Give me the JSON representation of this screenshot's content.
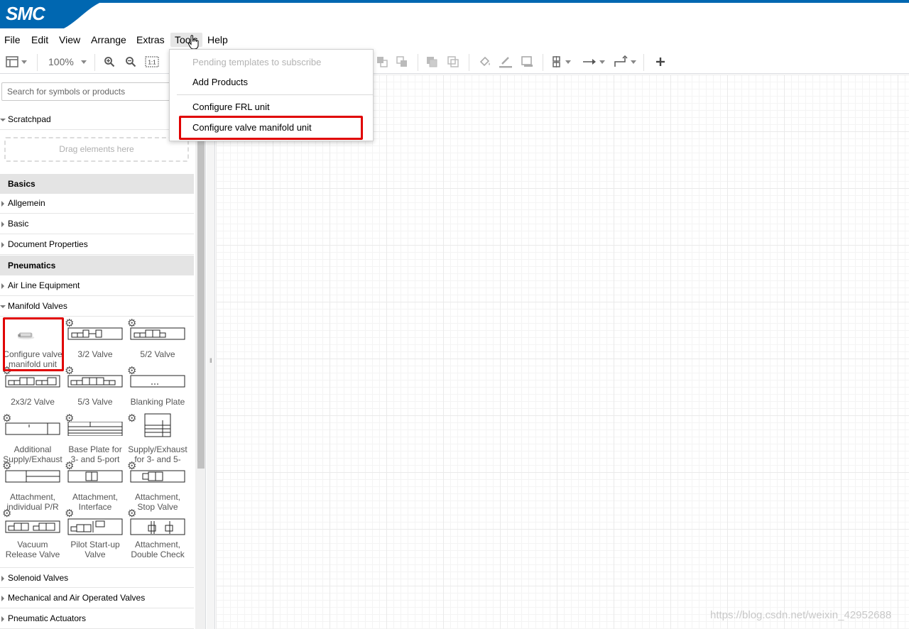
{
  "brand": {
    "logo_text": "SMC",
    "accent": "#0067b1",
    "highlight": "#e00000"
  },
  "menu": [
    "File",
    "Edit",
    "View",
    "Arrange",
    "Extras",
    "Tools",
    "Help"
  ],
  "toolbar": {
    "zoom": "100%"
  },
  "tools_menu": {
    "items": [
      {
        "label": "Pending templates to subscribe",
        "enabled": false
      },
      {
        "label": "Add Products",
        "enabled": true
      },
      {
        "label": "Configure FRL unit",
        "enabled": true
      },
      {
        "label": "Configure valve manifold unit",
        "enabled": true,
        "highlighted": true
      }
    ]
  },
  "sidebar": {
    "search_placeholder": "Search for symbols or products",
    "scratchpad": "Scratchpad",
    "drag_hint": "Drag elements here",
    "basics_header": "Basics",
    "basics_items": [
      "Allgemein",
      "Basic",
      "Document Properties"
    ],
    "pneumatics_header": "Pneumatics",
    "pneumatics_items": [
      "Air Line Equipment",
      "Manifold Valves"
    ],
    "tiles": [
      "Configure valve manifold unit",
      "3/2 Valve",
      "5/2 Valve",
      "2x3/2 Valve",
      "5/3 Valve",
      "Blanking Plate",
      "Additional Supply/Exhaust",
      "Base Plate for 3- and 5-port",
      "Supply/Exhaust for 3- and 5-",
      "Attachment, individual P/R",
      "Attachment, Interface",
      "Attachment, Stop Valve",
      "Vacuum Release Valve",
      "Pilot Start-up Valve",
      "Attachment, Double Check"
    ],
    "bottom_items": [
      "Solenoid Valves",
      "Mechanical and Air Operated Valves",
      "Pneumatic Actuators"
    ]
  },
  "watermark": "https://blog.csdn.net/weixin_42952688"
}
